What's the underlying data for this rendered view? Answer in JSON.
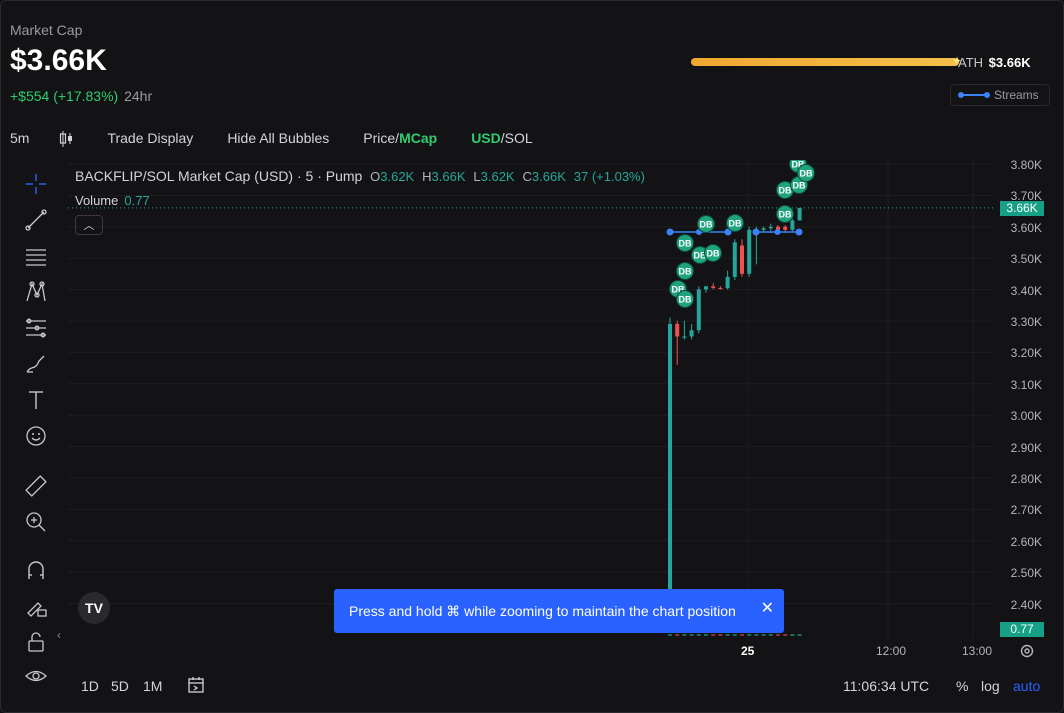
{
  "header": {
    "market_cap_label": "Market Cap",
    "market_cap_value": "$3.66K",
    "change_value": "+$554 (+17.83%)",
    "change_period": "24hr",
    "ath_label": "ATH",
    "ath_value": "$3.66K",
    "ath_progress_pct": 100,
    "streams_label": "Streams"
  },
  "toolbar": {
    "interval": "5m",
    "trade_display": "Trade Display",
    "hide_bubbles": "Hide All Bubbles",
    "price_label": "Price",
    "mcap_label": "MCap",
    "usd_label": "USD",
    "sol_label": "SOL"
  },
  "legend": {
    "symbol": "BACKFLIP/SOL Market Cap (USD) · 5 · Pump",
    "o_label": "O",
    "o": "3.62K",
    "h_label": "H",
    "h": "3.66K",
    "l_label": "L",
    "l": "3.62K",
    "c_label": "C",
    "c": "3.66K",
    "change": "37 (+1.03%)",
    "volume_label": "Volume",
    "volume_value": "0.77"
  },
  "price_axis": {
    "ticks": [
      "3.80K",
      "3.70K",
      "3.60K",
      "3.50K",
      "3.40K",
      "3.30K",
      "3.20K",
      "3.10K",
      "3.00K",
      "2.90K",
      "2.80K",
      "2.70K",
      "2.60K",
      "2.50K",
      "2.40K"
    ],
    "last_price_tag": "3.66K",
    "volume_tag": "0.77"
  },
  "time_axis": {
    "ticks": [
      "25",
      "12:00",
      "13:00"
    ]
  },
  "tooltip": {
    "text": "Press and hold ⌘ while zooming to maintain the chart position",
    "close": "✕"
  },
  "bottom": {
    "range_1d": "1D",
    "range_5d": "5D",
    "range_1m": "1M",
    "clock": "11:06:34 UTC",
    "percent": "%",
    "log": "log",
    "auto": "auto"
  },
  "bubble_label": "DB",
  "colors": {
    "up": "#26a69a",
    "down": "#ef5350",
    "bubble": "#1fa37e",
    "accent": "#2962ff",
    "stream": "#3b82f6"
  },
  "chart_data": {
    "type": "candlestick",
    "ylim": [
      2350,
      3850
    ],
    "candles": [
      {
        "o": 2400,
        "h": 3310,
        "l": 2350,
        "c": 3290
      },
      {
        "o": 3290,
        "h": 3300,
        "l": 3160,
        "c": 3250
      },
      {
        "o": 3250,
        "h": 3300,
        "l": 3240,
        "c": 3250
      },
      {
        "o": 3250,
        "h": 3290,
        "l": 3240,
        "c": 3270
      },
      {
        "o": 3270,
        "h": 3410,
        "l": 3260,
        "c": 3400
      },
      {
        "o": 3400,
        "h": 3410,
        "l": 3390,
        "c": 3410
      },
      {
        "o": 3410,
        "h": 3420,
        "l": 3400,
        "c": 3405
      },
      {
        "o": 3405,
        "h": 3410,
        "l": 3400,
        "c": 3404
      },
      {
        "o": 3404,
        "h": 3460,
        "l": 3400,
        "c": 3440
      },
      {
        "o": 3440,
        "h": 3560,
        "l": 3430,
        "c": 3550
      },
      {
        "o": 3540,
        "h": 3560,
        "l": 3440,
        "c": 3450
      },
      {
        "o": 3450,
        "h": 3600,
        "l": 3440,
        "c": 3590
      },
      {
        "o": 3590,
        "h": 3600,
        "l": 3480,
        "c": 3590
      },
      {
        "o": 3590,
        "h": 3600,
        "l": 3580,
        "c": 3595
      },
      {
        "o": 3595,
        "h": 3610,
        "l": 3580,
        "c": 3600
      },
      {
        "o": 3600,
        "h": 3605,
        "l": 3580,
        "c": 3590
      },
      {
        "o": 3600,
        "h": 3605,
        "l": 3580,
        "c": 3590
      },
      {
        "o": 3590,
        "h": 3630,
        "l": 3585,
        "c": 3620
      },
      {
        "o": 3620,
        "h": 3660,
        "l": 3620,
        "c": 3660
      }
    ]
  }
}
